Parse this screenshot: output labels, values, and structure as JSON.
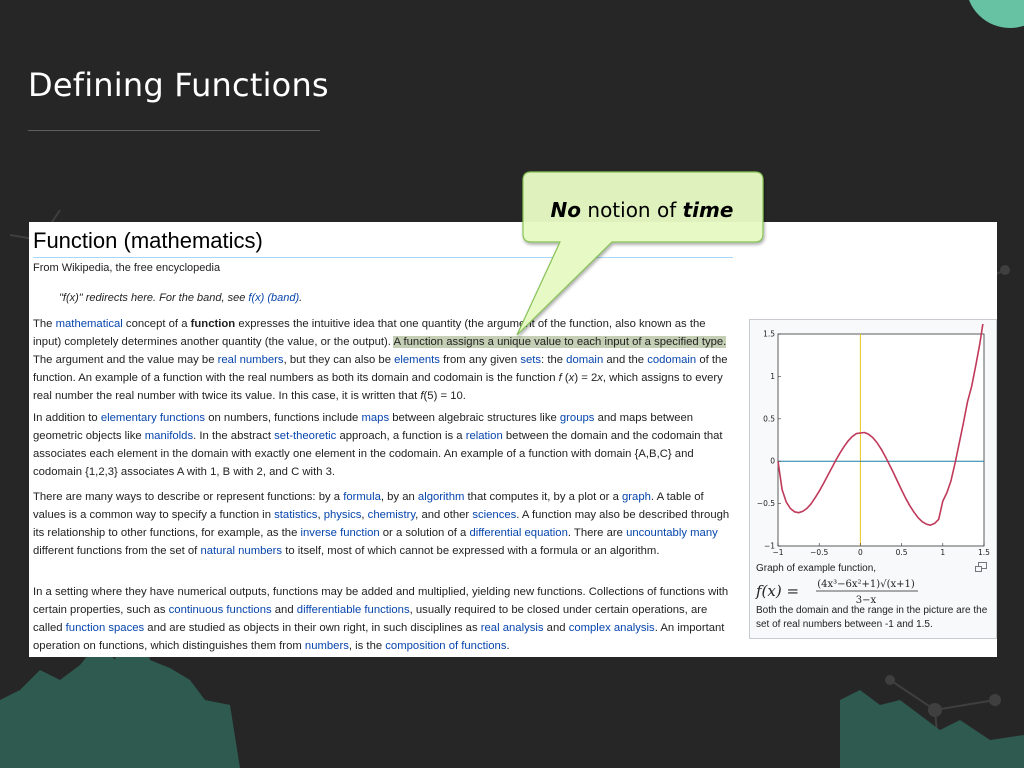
{
  "slide": {
    "title": "Defining Functions"
  },
  "callout": {
    "word1": "No",
    "word2": " notion of ",
    "word3": "time"
  },
  "wiki": {
    "title": "Function (mathematics)",
    "tagline": "From Wikipedia, the free encyclopedia",
    "hatnote": [
      {
        "t": "\"f(x)\" redirects here. For the band, see "
      },
      {
        "t": "f(x) (band)",
        "k": "lk"
      },
      {
        "t": "."
      }
    ],
    "paragraphs": [
      [
        {
          "t": "The "
        },
        {
          "t": "mathematical",
          "k": "lk"
        },
        {
          "t": " concept of a "
        },
        {
          "t": "function",
          "k": "b"
        },
        {
          "t": " expresses the intuitive idea that one quantity (the argument of the function, also known as the input) completely determines another quantity (the value, or the output). "
        },
        {
          "t": "A function assigns a unique value to each input of a specified type.",
          "k": "hl"
        },
        {
          "t": " The argument and the value may be "
        },
        {
          "t": "real numbers",
          "k": "lk"
        },
        {
          "t": ", but they can also be "
        },
        {
          "t": "elements",
          "k": "lk"
        },
        {
          "t": " from any given "
        },
        {
          "t": "sets",
          "k": "lk"
        },
        {
          "t": ": the "
        },
        {
          "t": "domain",
          "k": "lk"
        },
        {
          "t": " and the "
        },
        {
          "t": "codomain",
          "k": "lk"
        },
        {
          "t": " of the function. An example of a function with the real numbers as both its domain and codomain is the function "
        },
        {
          "t": "f",
          "k": "i"
        },
        {
          "t": " ("
        },
        {
          "t": "x",
          "k": "i"
        },
        {
          "t": ") = 2"
        },
        {
          "t": "x",
          "k": "i"
        },
        {
          "t": ", which assigns to every real number the real number with twice its value. In this case, it is written that "
        },
        {
          "t": "f",
          "k": "i"
        },
        {
          "t": "(5) = 10."
        }
      ],
      [
        {
          "t": "In addition to "
        },
        {
          "t": "elementary functions",
          "k": "lk"
        },
        {
          "t": " on numbers, functions include "
        },
        {
          "t": "maps",
          "k": "lk"
        },
        {
          "t": " between algebraic structures like "
        },
        {
          "t": "groups",
          "k": "lk"
        },
        {
          "t": " and maps between geometric objects like "
        },
        {
          "t": "manifolds",
          "k": "lk"
        },
        {
          "t": ". In the abstract "
        },
        {
          "t": "set-theoretic",
          "k": "lk"
        },
        {
          "t": " approach, a function is a "
        },
        {
          "t": "relation",
          "k": "lk"
        },
        {
          "t": " between the domain and the codomain that associates each element in the domain with exactly one element in the codomain. An example of a function with domain {A,B,C} and codomain {1,2,3} associates A with 1, B with 2, and C with 3."
        }
      ],
      [
        {
          "t": "There are many ways to describe or represent functions: by a "
        },
        {
          "t": "formula",
          "k": "lk"
        },
        {
          "t": ", by an "
        },
        {
          "t": "algorithm",
          "k": "lk"
        },
        {
          "t": " that computes it, by a plot or a "
        },
        {
          "t": "graph",
          "k": "lk"
        },
        {
          "t": ". A table of values is a common way to specify a function in "
        },
        {
          "t": "statistics",
          "k": "lk"
        },
        {
          "t": ", "
        },
        {
          "t": "physics",
          "k": "lk"
        },
        {
          "t": ", "
        },
        {
          "t": "chemistry",
          "k": "lk"
        },
        {
          "t": ", and other "
        },
        {
          "t": "sciences",
          "k": "lk"
        },
        {
          "t": ". A function may also be described through its relationship to other functions, for example, as the "
        },
        {
          "t": "inverse function",
          "k": "lk"
        },
        {
          "t": " or a solution of a "
        },
        {
          "t": "differential equation",
          "k": "lk"
        },
        {
          "t": ". There are "
        },
        {
          "t": "uncountably many",
          "k": "lk"
        },
        {
          "t": " different functions from the set of "
        },
        {
          "t": "natural numbers",
          "k": "lk"
        },
        {
          "t": " to itself, most of which cannot be expressed with a formula or an algorithm."
        }
      ],
      [
        {
          "t": "In a setting where they have numerical outputs, functions may be added and multiplied, yielding new functions. Collections of functions with certain properties, such as "
        },
        {
          "t": "continuous functions",
          "k": "lk"
        },
        {
          "t": " and "
        },
        {
          "t": "differentiable functions",
          "k": "lk"
        },
        {
          "t": ", usually required to be closed under certain operations, are called "
        },
        {
          "t": "function spaces",
          "k": "lk"
        },
        {
          "t": " and are studied as objects in their own right, in such disciplines as "
        },
        {
          "t": "real analysis",
          "k": "lk"
        },
        {
          "t": " and "
        },
        {
          "t": "complex analysis",
          "k": "lk"
        },
        {
          "t": ". An important operation on functions, which distinguishes them from "
        },
        {
          "t": "numbers",
          "k": "lk"
        },
        {
          "t": ", is the "
        },
        {
          "t": "composition of functions",
          "k": "lk"
        },
        {
          "t": "."
        }
      ]
    ],
    "figure": {
      "caption_title": "Graph of example function,",
      "formula_lhs": "f(x) =",
      "formula_num": "(4x³−6x²+1)√(x+1)",
      "formula_den": "3−x",
      "caption_desc": "Both the domain and the range in the picture are the set of real numbers between -1 and 1.5."
    }
  },
  "chart_data": {
    "type": "line",
    "title": "",
    "xlabel": "",
    "ylabel": "",
    "xlim": [
      -1,
      1.5
    ],
    "ylim": [
      -1,
      1.5
    ],
    "xticks": [
      "−1",
      "−0.5",
      "0",
      "0.5",
      "1",
      "1.5"
    ],
    "yticks": [
      "−1",
      "−0.5",
      "0",
      "0.5",
      "1",
      "1.5"
    ],
    "series": [
      {
        "values": [
          [
            -1.0,
            0.0
          ],
          [
            -0.95,
            -0.335
          ],
          [
            -0.9,
            -0.48
          ],
          [
            -0.85,
            -0.558
          ],
          [
            -0.8,
            -0.597
          ],
          [
            -0.75,
            -0.607
          ],
          [
            -0.7,
            -0.592
          ],
          [
            -0.65,
            -0.558
          ],
          [
            -0.6,
            -0.503
          ],
          [
            -0.55,
            -0.432
          ],
          [
            -0.5,
            -0.354
          ],
          [
            -0.45,
            -0.268
          ],
          [
            -0.4,
            -0.176
          ],
          [
            -0.35,
            -0.083
          ],
          [
            -0.3,
            0.008
          ],
          [
            -0.25,
            0.093
          ],
          [
            -0.2,
            0.17
          ],
          [
            -0.15,
            0.237
          ],
          [
            -0.1,
            0.29
          ],
          [
            -0.05,
            0.326
          ],
          [
            0.0,
            0.333
          ],
          [
            0.05,
            0.339
          ],
          [
            0.1,
            0.318
          ],
          [
            0.15,
            0.278
          ],
          [
            0.2,
            0.22
          ],
          [
            0.25,
            0.146
          ],
          [
            0.3,
            0.06
          ],
          [
            0.35,
            -0.035
          ],
          [
            0.4,
            -0.135
          ],
          [
            0.45,
            -0.238
          ],
          [
            0.5,
            -0.34
          ],
          [
            0.55,
            -0.437
          ],
          [
            0.6,
            -0.525
          ],
          [
            0.65,
            -0.602
          ],
          [
            0.7,
            -0.666
          ],
          [
            0.75,
            -0.713
          ],
          [
            0.8,
            -0.742
          ],
          [
            0.85,
            -0.755
          ],
          [
            0.9,
            -0.733
          ],
          [
            0.95,
            -0.685
          ],
          [
            1.0,
            -0.471
          ],
          [
            1.05,
            -0.37
          ],
          [
            1.1,
            -0.23
          ],
          [
            1.15,
            -0.015
          ],
          [
            1.2,
            0.217
          ],
          [
            1.25,
            0.45
          ],
          [
            1.3,
            0.7
          ],
          [
            1.35,
            0.88
          ],
          [
            1.4,
            1.13
          ],
          [
            1.45,
            1.39
          ],
          [
            1.5,
            1.708
          ]
        ]
      }
    ],
    "colors": {
      "curve": "#c0395a",
      "x_axis": "#1f7ea6",
      "y_axis": "#e6c619",
      "highlight": "#96a878",
      "callout_fill": "#e8fcc4"
    }
  }
}
